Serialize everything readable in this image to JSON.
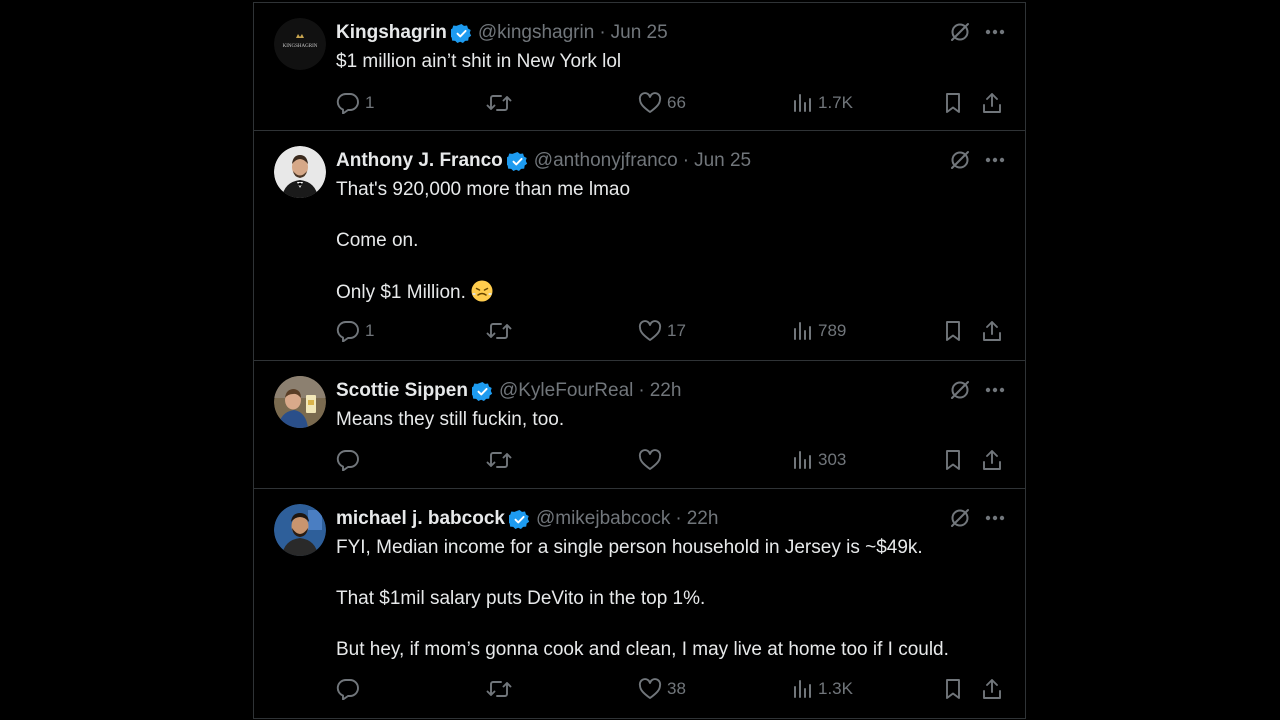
{
  "tweets": [
    {
      "name": "Kingshagrin",
      "handle": "@kingshagrin",
      "separator": "·",
      "time": "Jun 25",
      "lines": [
        "$1 million ain’t shit in New York lol"
      ],
      "stats": {
        "replies": "1",
        "retweets": "",
        "likes": "66",
        "views": "1.7K"
      },
      "avatar_text": "KINGSHAGRIN"
    },
    {
      "name": "Anthony J. Franco",
      "handle": "@anthonyjfranco",
      "separator": "·",
      "time": "Jun 25",
      "lines": [
        "That's 920,000 more than me lmao",
        "Come on.",
        "Only $1 Million."
      ],
      "stats": {
        "replies": "1",
        "retweets": "",
        "likes": "17",
        "views": "789"
      }
    },
    {
      "name": "Scottie Sippen",
      "handle": "@KyleFourReal",
      "separator": "·",
      "time": "22h",
      "lines": [
        "Means they still fuckin, too."
      ],
      "stats": {
        "replies": "",
        "retweets": "",
        "likes": "",
        "views": "303"
      }
    },
    {
      "name": "michael j. babcock",
      "handle": "@mikejbabcock",
      "separator": "·",
      "time": "22h",
      "lines": [
        "FYI, Median income for a single person household in Jersey is ~$49k.",
        "That $1mil salary puts DeVito in the top 1%.",
        "But hey, if mom’s gonna cook and clean, I may live at home too if I could."
      ],
      "stats": {
        "replies": "",
        "retweets": "",
        "likes": "38",
        "views": "1.3K"
      }
    }
  ],
  "icons": {
    "verified": "verified-badge-icon",
    "grok": "grok-icon",
    "more": "more-icon",
    "reply": "reply-icon",
    "retweet": "retweet-icon",
    "like": "heart-icon",
    "views": "views-icon",
    "bookmark": "bookmark-icon",
    "share": "share-icon",
    "emoji": "steam-face-emoji"
  },
  "colors": {
    "background": "#000000",
    "text": "#e7e9ea",
    "muted": "#71767b",
    "border": "#2f3336",
    "verified": "#1d9bf0"
  }
}
